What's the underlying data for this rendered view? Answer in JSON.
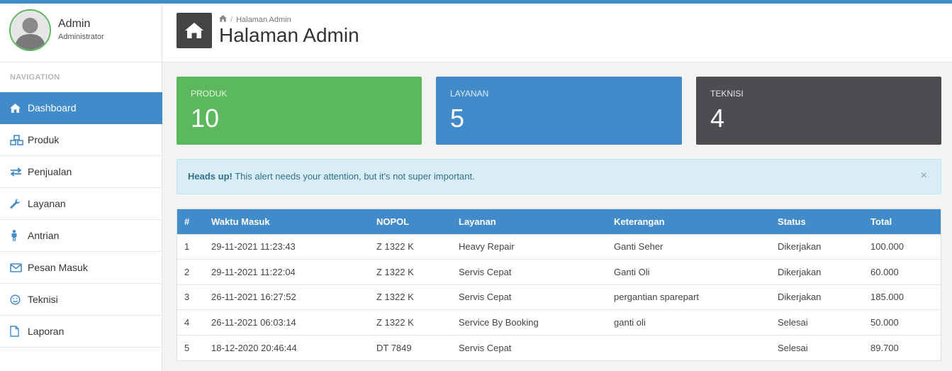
{
  "profile": {
    "name": "Admin",
    "role": "Administrator"
  },
  "nav": {
    "title": "NAVIGATION",
    "items": [
      {
        "label": "Dashboard",
        "icon": "home-icon"
      },
      {
        "label": "Produk",
        "icon": "cubes-icon"
      },
      {
        "label": "Penjualan",
        "icon": "exchange-icon"
      },
      {
        "label": "Layanan",
        "icon": "wrench-icon"
      },
      {
        "label": "Antrian",
        "icon": "person-icon"
      },
      {
        "label": "Pesan Masuk",
        "icon": "envelope-icon"
      },
      {
        "label": "Teknisi",
        "icon": "smile-icon"
      },
      {
        "label": "Laporan",
        "icon": "file-icon"
      }
    ]
  },
  "header": {
    "breadcrumb": "Halaman Admin",
    "title": "Halaman Admin"
  },
  "stats": [
    {
      "label": "PRODUK",
      "value": "10"
    },
    {
      "label": "LAYANAN",
      "value": "5"
    },
    {
      "label": "TEKNISI",
      "value": "4"
    }
  ],
  "alert": {
    "strong": "Heads up!",
    "text": " This alert needs your attention, but it's not super important.",
    "close": "×"
  },
  "table": {
    "headers": [
      "#",
      "Waktu Masuk",
      "NOPOL",
      "Layanan",
      "Keterangan",
      "Status",
      "Total"
    ],
    "rows": [
      [
        "1",
        "29-11-2021 11:23:43",
        "Z 1322 K",
        "Heavy Repair",
        "Ganti Seher",
        "Dikerjakan",
        "100.000"
      ],
      [
        "2",
        "29-11-2021 11:22:04",
        "Z 1322 K",
        "Servis Cepat",
        "Ganti Oli",
        "Dikerjakan",
        "60.000"
      ],
      [
        "3",
        "26-11-2021 16:27:52",
        "Z 1322 K",
        "Servis Cepat",
        "pergantian sparepart",
        "Dikerjakan",
        "185.000"
      ],
      [
        "4",
        "26-11-2021 06:03:14",
        "Z 1322 K",
        "Service By Booking",
        "ganti oli",
        "Selesai",
        "50.000"
      ],
      [
        "5",
        "18-12-2020 20:46:44",
        "DT 7849",
        "Servis Cepat",
        "",
        "Selesai",
        "89.700"
      ]
    ]
  },
  "colors": {
    "accent": "#428bca",
    "success": "#5cb85c",
    "dark": "#4b4d50",
    "info_bg": "#d9edf7"
  }
}
